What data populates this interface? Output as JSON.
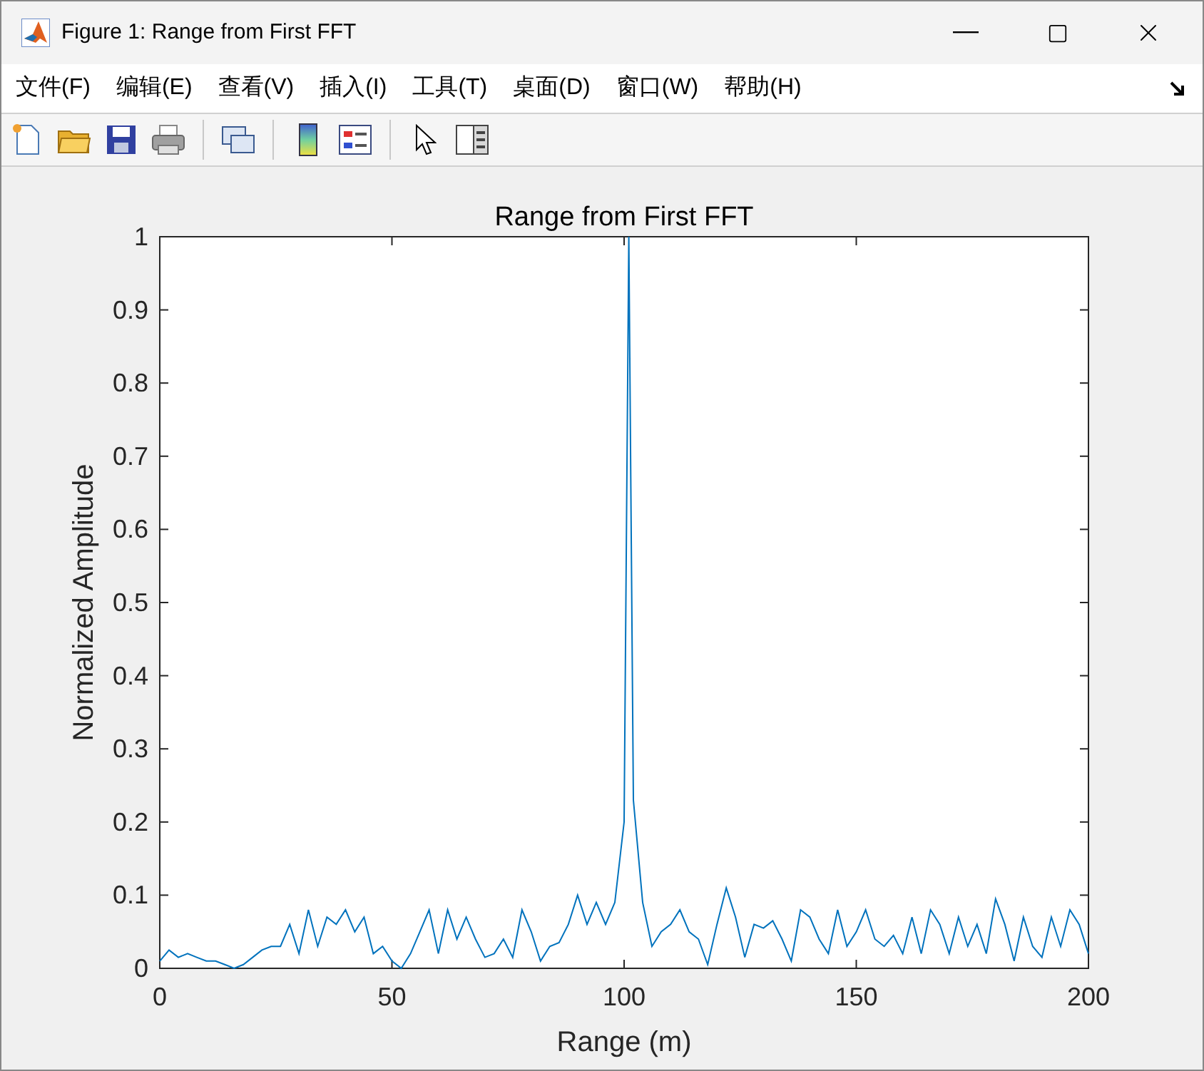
{
  "window": {
    "title": "Figure 1: Range from First FFT"
  },
  "menu": [
    {
      "label": "文件(F)"
    },
    {
      "label": "编辑(E)"
    },
    {
      "label": "查看(V)"
    },
    {
      "label": "插入(I)"
    },
    {
      "label": "工具(T)"
    },
    {
      "label": "桌面(D)"
    },
    {
      "label": "窗口(W)"
    },
    {
      "label": "帮助(H)"
    }
  ],
  "toolbar": [
    {
      "kind": "new"
    },
    {
      "kind": "open"
    },
    {
      "kind": "save"
    },
    {
      "kind": "print"
    },
    {
      "kind": "separator"
    },
    {
      "kind": "link"
    },
    {
      "kind": "separator"
    },
    {
      "kind": "colorbar"
    },
    {
      "kind": "legend"
    },
    {
      "kind": "separator"
    },
    {
      "kind": "pointer"
    },
    {
      "kind": "panel"
    }
  ],
  "figure": {
    "chart_data": {
      "type": "line",
      "title": "Range from First FFT",
      "xlabel": "Range (m)",
      "ylabel": "Normalized Amplitude",
      "xlim": [
        0,
        200
      ],
      "ylim": [
        0,
        1
      ],
      "xticks": [
        0,
        50,
        100,
        150,
        200
      ],
      "yticks": [
        0,
        0.1,
        0.2,
        0.3,
        0.4,
        0.5,
        0.6,
        0.7,
        0.8,
        0.9,
        1
      ],
      "x": [
        0,
        2,
        4,
        6,
        8,
        10,
        12,
        14,
        16,
        18,
        20,
        22,
        24,
        26,
        28,
        30,
        32,
        34,
        36,
        38,
        40,
        42,
        44,
        46,
        48,
        50,
        52,
        54,
        56,
        58,
        60,
        62,
        64,
        66,
        68,
        70,
        72,
        74,
        76,
        78,
        80,
        82,
        84,
        86,
        88,
        90,
        92,
        94,
        96,
        98,
        100,
        101,
        102,
        104,
        106,
        108,
        110,
        112,
        114,
        116,
        118,
        120,
        122,
        124,
        126,
        128,
        130,
        132,
        134,
        136,
        138,
        140,
        142,
        144,
        146,
        148,
        150,
        152,
        154,
        156,
        158,
        160,
        162,
        164,
        166,
        168,
        170,
        172,
        174,
        176,
        178,
        180,
        182,
        184,
        186,
        188,
        190,
        192,
        194,
        196,
        198,
        200
      ],
      "series": [
        {
          "color": "#0072bd",
          "values": [
            0.01,
            0.025,
            0.015,
            0.02,
            0.015,
            0.01,
            0.01,
            0.005,
            0,
            0.005,
            0.015,
            0.025,
            0.03,
            0.03,
            0.06,
            0.02,
            0.08,
            0.03,
            0.07,
            0.06,
            0.08,
            0.05,
            0.07,
            0.02,
            0.03,
            0.01,
            0,
            0.02,
            0.05,
            0.08,
            0.02,
            0.08,
            0.04,
            0.07,
            0.04,
            0.015,
            0.02,
            0.04,
            0.015,
            0.08,
            0.05,
            0.01,
            0.03,
            0.035,
            0.06,
            0.1,
            0.06,
            0.09,
            0.06,
            0.09,
            0.2,
            1,
            0.23,
            0.09,
            0.03,
            0.05,
            0.06,
            0.08,
            0.05,
            0.04,
            0.005,
            0.06,
            0.11,
            0.07,
            0.015,
            0.06,
            0.055,
            0.065,
            0.04,
            0.01,
            0.08,
            0.07,
            0.04,
            0.02,
            0.08,
            0.03,
            0.05,
            0.08,
            0.04,
            0.03,
            0.045,
            0.02,
            0.07,
            0.02,
            0.08,
            0.06,
            0.02,
            0.07,
            0.03,
            0.06,
            0.02,
            0.095,
            0.06,
            0.01,
            0.07,
            0.03,
            0.015,
            0.07,
            0.03,
            0.08,
            0.06,
            0.02
          ]
        }
      ]
    }
  }
}
